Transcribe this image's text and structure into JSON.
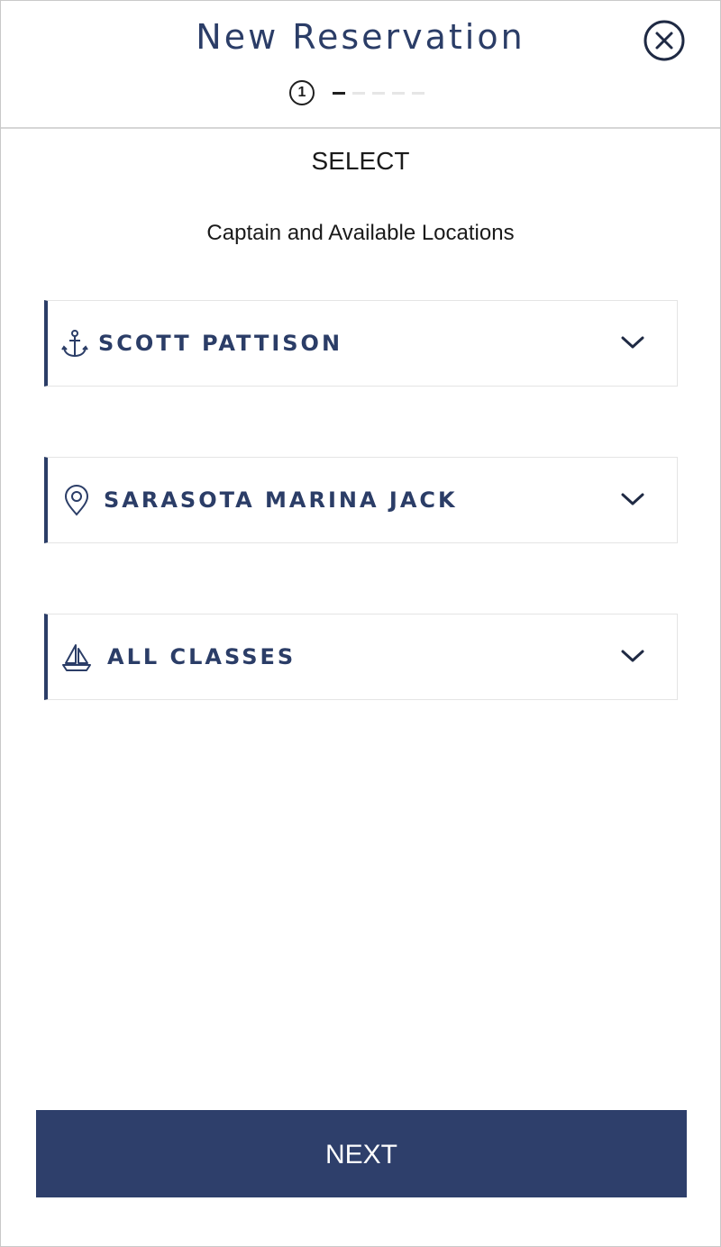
{
  "header": {
    "title": "New Reservation",
    "close_icon": "close-circle-icon",
    "progress": {
      "current_step": "1",
      "total_steps": 5
    }
  },
  "main": {
    "section_title": "SELECT",
    "subtitle": "Captain and Available Locations",
    "fields": [
      {
        "icon": "anchor-icon",
        "value": "SCOTT PATTISON"
      },
      {
        "icon": "location-pin-icon",
        "value": "SARASOTA MARINA JACK"
      },
      {
        "icon": "sailboat-icon",
        "value": "ALL CLASSES"
      }
    ]
  },
  "footer": {
    "next_label": "NEXT"
  },
  "colors": {
    "brand": "#2b3d67",
    "button": "#2e3f6b",
    "divider": "#d6d6d6"
  }
}
